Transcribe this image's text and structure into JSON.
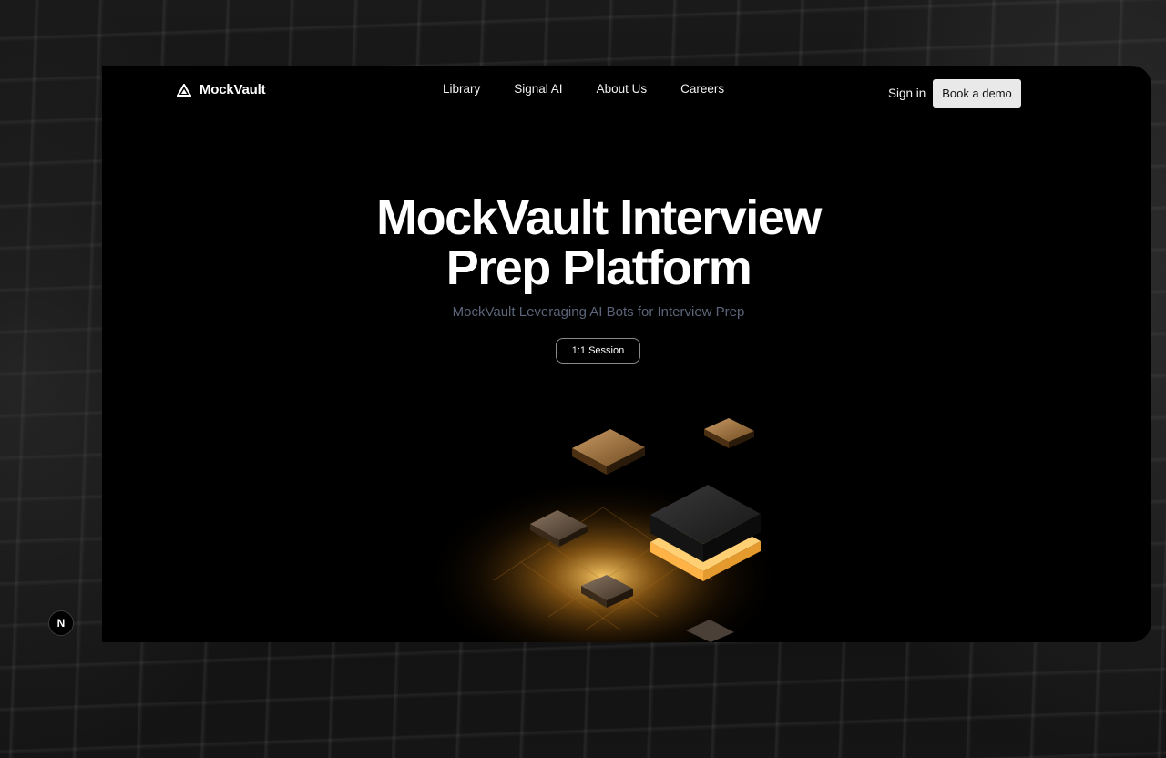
{
  "brand": {
    "name": "MockVault",
    "icon": "triangle-logo-icon"
  },
  "nav": {
    "links": [
      "Library",
      "Signal AI",
      "About Us",
      "Careers"
    ],
    "signin_label": "Sign in",
    "demo_label": "Book a demo"
  },
  "hero": {
    "title_line1": "MockVault Interview",
    "title_line2": "Prep Platform",
    "subtitle": "MockVault Leveraging AI Bots for Interview Prep",
    "cta_label": "1:1 Session"
  },
  "badge": {
    "label": "N"
  },
  "colors": {
    "card_bg": "#000000",
    "demo_button_bg": "#e9e9e9",
    "subtitle": "#5b6478",
    "glow": "#f5b13a"
  }
}
